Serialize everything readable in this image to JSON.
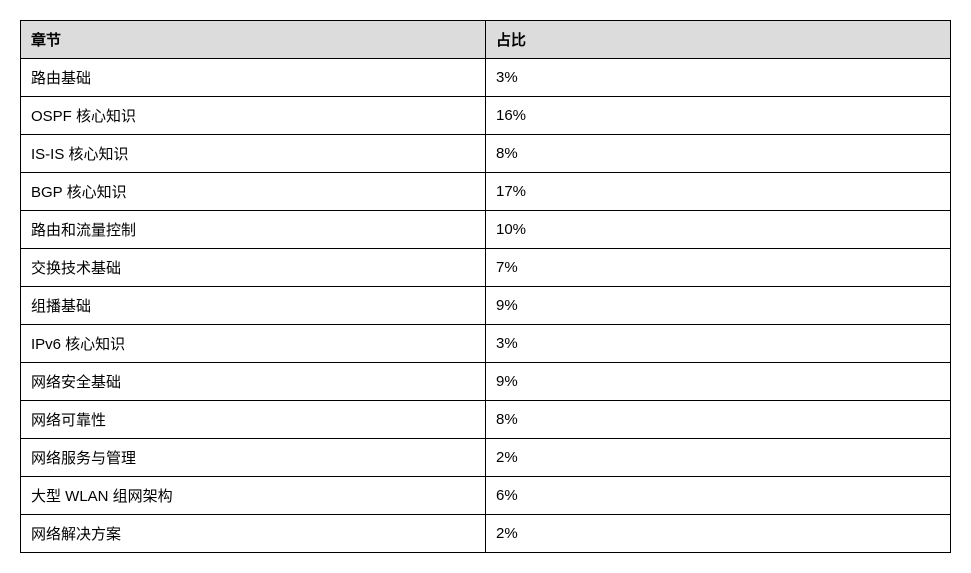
{
  "table": {
    "headers": {
      "chapter": "章节",
      "ratio": "占比"
    },
    "rows": [
      {
        "chapter": "路由基础",
        "ratio": "3%"
      },
      {
        "chapter": "OSPF 核心知识",
        "ratio": "16%"
      },
      {
        "chapter": "IS-IS 核心知识",
        "ratio": "8%"
      },
      {
        "chapter": "BGP 核心知识",
        "ratio": "17%"
      },
      {
        "chapter": "路由和流量控制",
        "ratio": "10%"
      },
      {
        "chapter": "交换技术基础",
        "ratio": "7%"
      },
      {
        "chapter": "组播基础",
        "ratio": "9%"
      },
      {
        "chapter": "IPv6 核心知识",
        "ratio": "3%"
      },
      {
        "chapter": "网络安全基础",
        "ratio": "9%"
      },
      {
        "chapter": "网络可靠性",
        "ratio": "8%"
      },
      {
        "chapter": "网络服务与管理",
        "ratio": "2%"
      },
      {
        "chapter": "大型 WLAN 组网架构",
        "ratio": "6%"
      },
      {
        "chapter": "网络解决方案",
        "ratio": "2%"
      }
    ]
  }
}
